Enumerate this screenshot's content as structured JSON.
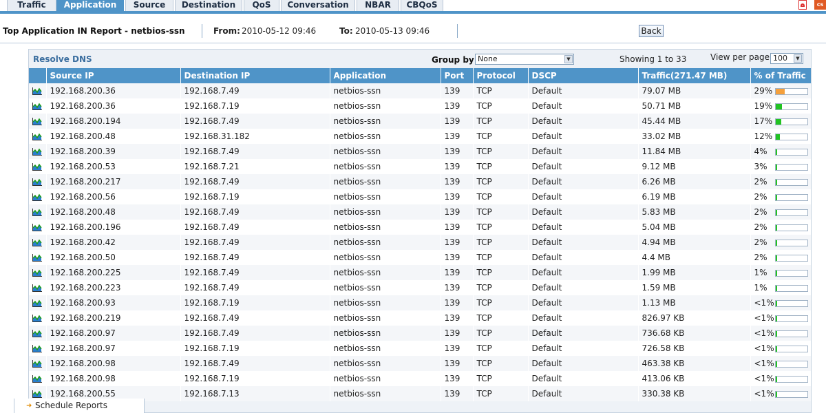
{
  "tabs": [
    {
      "label": "Traffic",
      "active": false
    },
    {
      "label": "Application",
      "active": true
    },
    {
      "label": "Source",
      "active": false
    },
    {
      "label": "Destination",
      "active": false
    },
    {
      "label": "QoS",
      "active": false
    },
    {
      "label": "Conversation",
      "active": false
    },
    {
      "label": "NBAR",
      "active": false
    },
    {
      "label": "CBQoS",
      "active": false
    }
  ],
  "icons": {
    "pdf": "pdf-export-icon",
    "csv": "csv-export-icon",
    "csv_text": "cs"
  },
  "report": {
    "title": "Top Application IN Report - netbios-ssn",
    "from_label": "From:",
    "from_value": "2010-05-12 09:46",
    "to_label": "To:",
    "to_value": "2010-05-13 09:46",
    "back_label": "Back"
  },
  "toolbar": {
    "resolve_dns": "Resolve DNS",
    "group_by_label": "Group by",
    "group_by_value": "None",
    "showing": "Showing 1 to 33",
    "view_per_page_label": "View per page",
    "view_per_page_value": "100"
  },
  "columns": [
    "Source IP",
    "Destination IP",
    "Application",
    "Port",
    "Protocol",
    "DSCP",
    "Traffic(271.47 MB)",
    "% of Traffic"
  ],
  "rows": [
    {
      "src": "192.168.200.36",
      "dst": "192.168.7.49",
      "app": "netbios-ssn",
      "port": "139",
      "proto": "TCP",
      "dscp": "Default",
      "traffic": "79.07 MB",
      "pct": "29%",
      "fill": 0.29,
      "color": "#f5a03c"
    },
    {
      "src": "192.168.200.36",
      "dst": "192.168.7.19",
      "app": "netbios-ssn",
      "port": "139",
      "proto": "TCP",
      "dscp": "Default",
      "traffic": "50.71 MB",
      "pct": "19%",
      "fill": 0.19,
      "color": "#22c322"
    },
    {
      "src": "192.168.200.194",
      "dst": "192.168.7.49",
      "app": "netbios-ssn",
      "port": "139",
      "proto": "TCP",
      "dscp": "Default",
      "traffic": "45.44 MB",
      "pct": "17%",
      "fill": 0.17,
      "color": "#22c322"
    },
    {
      "src": "192.168.200.48",
      "dst": "192.168.31.182",
      "app": "netbios-ssn",
      "port": "139",
      "proto": "TCP",
      "dscp": "Default",
      "traffic": "33.02 MB",
      "pct": "12%",
      "fill": 0.12,
      "color": "#22c322"
    },
    {
      "src": "192.168.200.39",
      "dst": "192.168.7.49",
      "app": "netbios-ssn",
      "port": "139",
      "proto": "TCP",
      "dscp": "Default",
      "traffic": "11.84 MB",
      "pct": "4%",
      "fill": 0.04,
      "color": "#22c322"
    },
    {
      "src": "192.168.200.53",
      "dst": "192.168.7.21",
      "app": "netbios-ssn",
      "port": "139",
      "proto": "TCP",
      "dscp": "Default",
      "traffic": "9.12 MB",
      "pct": "3%",
      "fill": 0.03,
      "color": "#22c322"
    },
    {
      "src": "192.168.200.217",
      "dst": "192.168.7.49",
      "app": "netbios-ssn",
      "port": "139",
      "proto": "TCP",
      "dscp": "Default",
      "traffic": "6.26 MB",
      "pct": "2%",
      "fill": 0.02,
      "color": "#22c322"
    },
    {
      "src": "192.168.200.56",
      "dst": "192.168.7.19",
      "app": "netbios-ssn",
      "port": "139",
      "proto": "TCP",
      "dscp": "Default",
      "traffic": "6.19 MB",
      "pct": "2%",
      "fill": 0.02,
      "color": "#22c322"
    },
    {
      "src": "192.168.200.48",
      "dst": "192.168.7.49",
      "app": "netbios-ssn",
      "port": "139",
      "proto": "TCP",
      "dscp": "Default",
      "traffic": "5.83 MB",
      "pct": "2%",
      "fill": 0.02,
      "color": "#22c322"
    },
    {
      "src": "192.168.200.196",
      "dst": "192.168.7.49",
      "app": "netbios-ssn",
      "port": "139",
      "proto": "TCP",
      "dscp": "Default",
      "traffic": "5.04 MB",
      "pct": "2%",
      "fill": 0.02,
      "color": "#22c322"
    },
    {
      "src": "192.168.200.42",
      "dst": "192.168.7.49",
      "app": "netbios-ssn",
      "port": "139",
      "proto": "TCP",
      "dscp": "Default",
      "traffic": "4.94 MB",
      "pct": "2%",
      "fill": 0.02,
      "color": "#22c322"
    },
    {
      "src": "192.168.200.50",
      "dst": "192.168.7.49",
      "app": "netbios-ssn",
      "port": "139",
      "proto": "TCP",
      "dscp": "Default",
      "traffic": "4.4 MB",
      "pct": "2%",
      "fill": 0.02,
      "color": "#22c322"
    },
    {
      "src": "192.168.200.225",
      "dst": "192.168.7.49",
      "app": "netbios-ssn",
      "port": "139",
      "proto": "TCP",
      "dscp": "Default",
      "traffic": "1.99 MB",
      "pct": "1%",
      "fill": 0.01,
      "color": "#22c322"
    },
    {
      "src": "192.168.200.223",
      "dst": "192.168.7.49",
      "app": "netbios-ssn",
      "port": "139",
      "proto": "TCP",
      "dscp": "Default",
      "traffic": "1.59 MB",
      "pct": "1%",
      "fill": 0.01,
      "color": "#22c322"
    },
    {
      "src": "192.168.200.93",
      "dst": "192.168.7.19",
      "app": "netbios-ssn",
      "port": "139",
      "proto": "TCP",
      "dscp": "Default",
      "traffic": "1.13 MB",
      "pct": "<1%",
      "fill": 0.005,
      "color": "#22c322"
    },
    {
      "src": "192.168.200.219",
      "dst": "192.168.7.49",
      "app": "netbios-ssn",
      "port": "139",
      "proto": "TCP",
      "dscp": "Default",
      "traffic": "826.97 KB",
      "pct": "<1%",
      "fill": 0.005,
      "color": "#22c322"
    },
    {
      "src": "192.168.200.97",
      "dst": "192.168.7.49",
      "app": "netbios-ssn",
      "port": "139",
      "proto": "TCP",
      "dscp": "Default",
      "traffic": "736.68 KB",
      "pct": "<1%",
      "fill": 0.005,
      "color": "#22c322"
    },
    {
      "src": "192.168.200.97",
      "dst": "192.168.7.19",
      "app": "netbios-ssn",
      "port": "139",
      "proto": "TCP",
      "dscp": "Default",
      "traffic": "726.58 KB",
      "pct": "<1%",
      "fill": 0.005,
      "color": "#22c322"
    },
    {
      "src": "192.168.200.98",
      "dst": "192.168.7.49",
      "app": "netbios-ssn",
      "port": "139",
      "proto": "TCP",
      "dscp": "Default",
      "traffic": "463.38 KB",
      "pct": "<1%",
      "fill": 0.005,
      "color": "#22c322"
    },
    {
      "src": "192.168.200.98",
      "dst": "192.168.7.19",
      "app": "netbios-ssn",
      "port": "139",
      "proto": "TCP",
      "dscp": "Default",
      "traffic": "413.06 KB",
      "pct": "<1%",
      "fill": 0.005,
      "color": "#22c322"
    },
    {
      "src": "192.168.200.55",
      "dst": "192.168.7.13",
      "app": "netbios-ssn",
      "port": "139",
      "proto": "TCP",
      "dscp": "Default",
      "traffic": "330.38 KB",
      "pct": "<1%",
      "fill": 0.005,
      "color": "#22c322"
    }
  ],
  "side_nav": {
    "schedule_reports": "Schedule Reports"
  }
}
